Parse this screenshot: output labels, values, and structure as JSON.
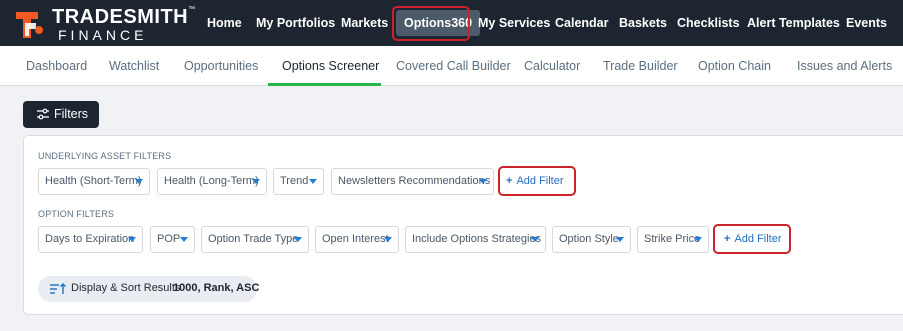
{
  "brand": {
    "name_line1": "TRADESMITH",
    "trademark": "™",
    "name_line2": "FINANCE",
    "accent_color": "#f15a22"
  },
  "topnav": {
    "items": [
      {
        "label": "Home",
        "active": false
      },
      {
        "label": "My Portfolios",
        "active": false
      },
      {
        "label": "Markets",
        "active": false
      },
      {
        "label": "Options360",
        "active": true
      },
      {
        "label": "My Services",
        "active": false
      },
      {
        "label": "Calendar",
        "active": false
      },
      {
        "label": "Baskets",
        "active": false
      },
      {
        "label": "Checklists",
        "active": false
      },
      {
        "label": "Alert Templates",
        "active": false
      },
      {
        "label": "Events",
        "active": false
      }
    ]
  },
  "subnav": {
    "items": [
      {
        "label": "Dashboard",
        "active": false
      },
      {
        "label": "Watchlist",
        "active": false
      },
      {
        "label": "Opportunities",
        "active": false
      },
      {
        "label": "Options Screener",
        "active": true
      },
      {
        "label": "Covered Call Builder",
        "active": false
      },
      {
        "label": "Calculator",
        "active": false
      },
      {
        "label": "Trade Builder",
        "active": false
      },
      {
        "label": "Option Chain",
        "active": false
      },
      {
        "label": "Issues and Alerts",
        "active": false
      }
    ],
    "active_underline_color": "#2bb34b"
  },
  "filters_button": {
    "label": "Filters",
    "icon": "sliders-icon"
  },
  "underlying_filters": {
    "title": "UNDERLYING ASSET FILTERS",
    "chips": [
      "Health (Short-Term)",
      "Health (Long-Term)",
      "Trend",
      "Newsletters Recommendations"
    ],
    "add_label": "Add Filter"
  },
  "option_filters": {
    "title": "OPTION FILTERS",
    "chips": [
      "Days to Expiration",
      "POP",
      "Option Trade Type",
      "Open Interest",
      "Include Options Strategies",
      "Option Style",
      "Strike Price"
    ],
    "add_label": "Add Filter"
  },
  "display_sort": {
    "label": "Display & Sort Results",
    "value": "1000, Rank, ASC",
    "icon": "sort-icon"
  },
  "colors": {
    "nav_bg": "#1c2530",
    "highlight_red": "#cc2229",
    "link_blue": "#1f6fc0",
    "caret_blue": "#1f7fd6"
  }
}
